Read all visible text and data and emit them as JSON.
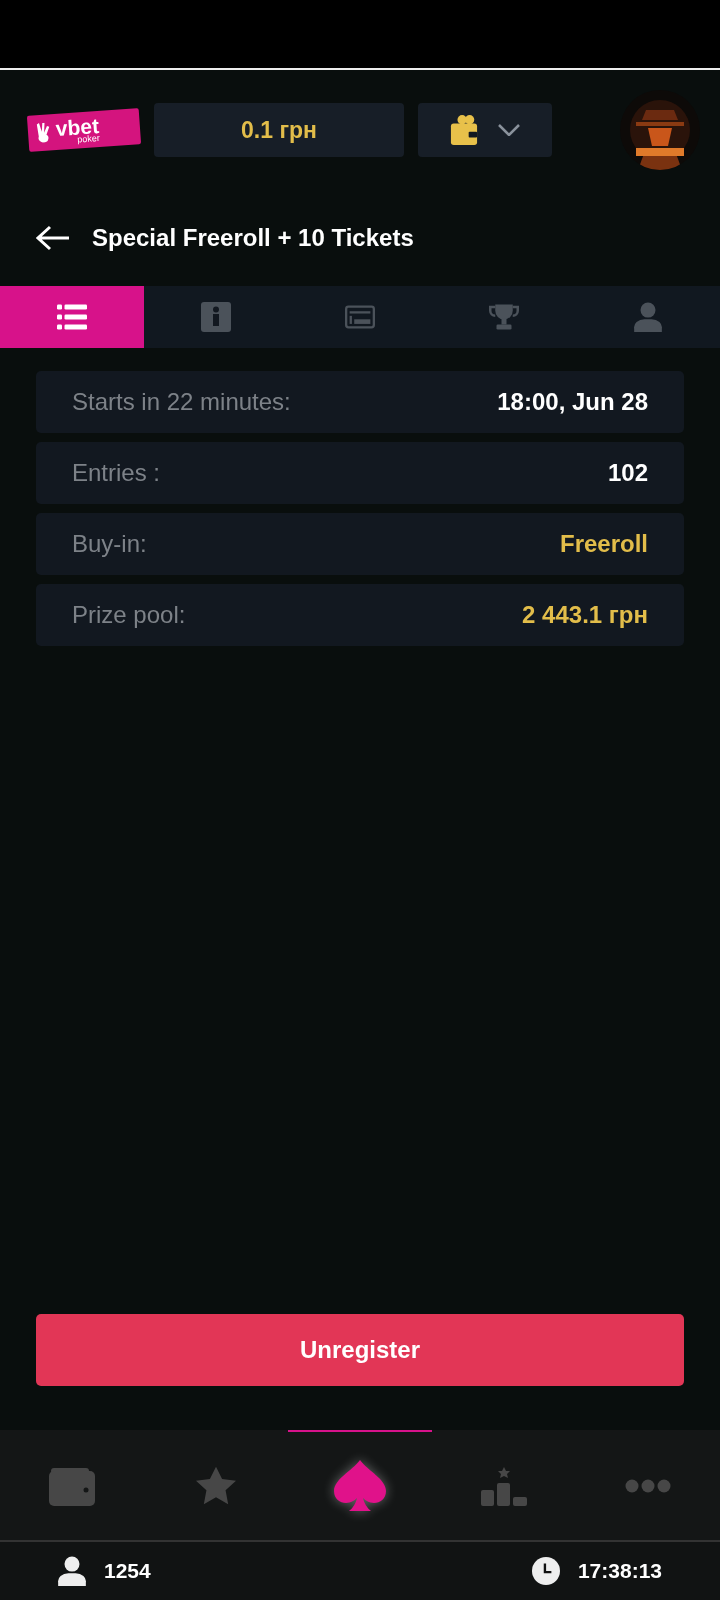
{
  "header": {
    "logo": {
      "word": "vbet",
      "sub": "poker"
    },
    "balance": "0.1 грн"
  },
  "title": "Special Freeroll + 10 Tickets",
  "tabs": [
    {
      "selected": true
    },
    {
      "selected": false
    },
    {
      "selected": false
    },
    {
      "selected": false
    },
    {
      "selected": false
    }
  ],
  "details": [
    {
      "label": "Starts in 22 minutes:",
      "value": "18:00, Jun 28",
      "highlight": false
    },
    {
      "label": "Entries :",
      "value": "102",
      "highlight": false
    },
    {
      "label": "Buy-in:",
      "value": "Freeroll",
      "highlight": true
    },
    {
      "label": "Prize pool:",
      "value": "2 443.1 грн",
      "highlight": true
    }
  ],
  "action_button": "Unregister",
  "bottom_nav": [
    {
      "selected": false
    },
    {
      "selected": false
    },
    {
      "selected": true
    },
    {
      "selected": false
    },
    {
      "selected": false
    }
  ],
  "footer": {
    "players": "1254",
    "time": "17:38:13"
  }
}
